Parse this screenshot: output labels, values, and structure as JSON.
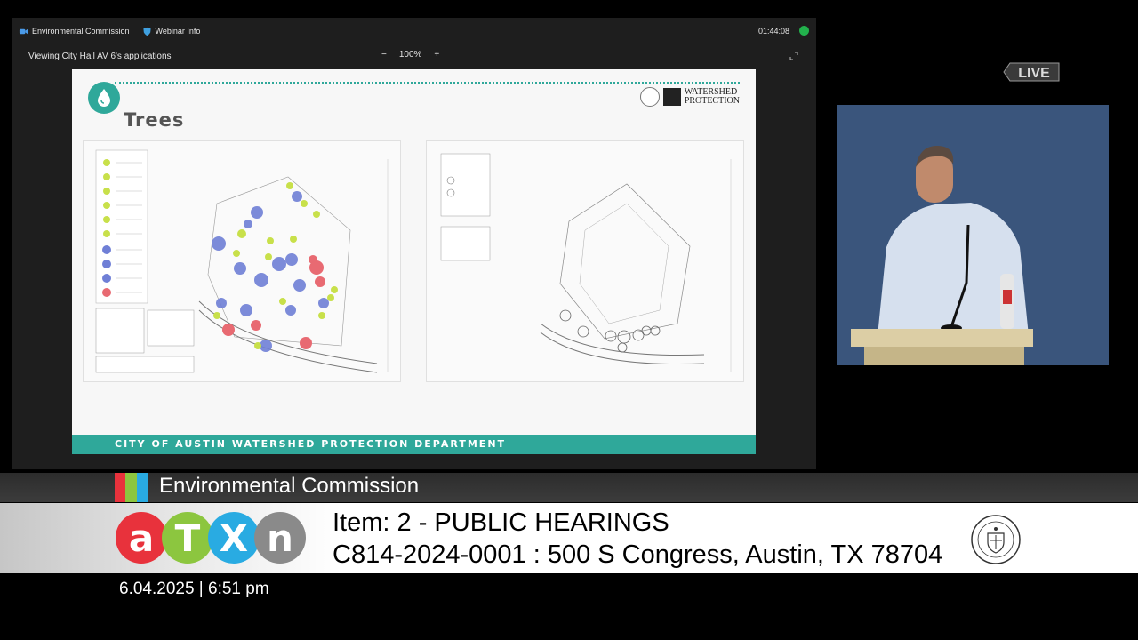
{
  "webinar": {
    "tabs": [
      {
        "label": "Environmental Commission",
        "icon": "zoom-icon"
      },
      {
        "label": "Webinar Info",
        "icon": "shield-icon"
      }
    ],
    "timer": "01:44:08",
    "viewing_label": "Viewing City Hall AV 6's applications",
    "zoom": {
      "minus": "−",
      "value": "100%",
      "plus": "+"
    }
  },
  "slide": {
    "title": "Trees",
    "logo_text_line1": "WATERSHED",
    "logo_text_line2": "PROTECTION",
    "footer": "CITY OF AUSTIN WATERSHED PROTECTION DEPARTMENT",
    "accent": "#2fa89a"
  },
  "live_badge": "LIVE",
  "lower_third": {
    "commission": "Environmental Commission",
    "item_line": "Item: 2 - PUBLIC HEARINGS",
    "case_line": "C814-2024-0001 : 500 S Congress, Austin, TX 78704",
    "logo_letters": [
      "a",
      "T",
      "X",
      "n"
    ],
    "logo_colors": [
      "#e8323c",
      "#8cc63f",
      "#29abe2",
      "#8a8a8a"
    ],
    "stripe_colors": [
      "#e8323c",
      "#8cc63f",
      "#29abe2"
    ],
    "date_time": "6.04.2025 | 6:51 pm"
  }
}
